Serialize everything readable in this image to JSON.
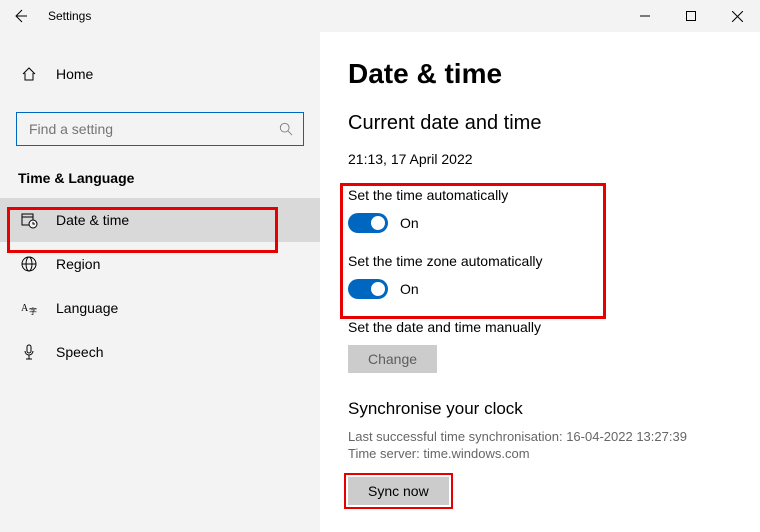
{
  "window": {
    "title": "Settings"
  },
  "sidebar": {
    "home": "Home",
    "search_placeholder": "Find a setting",
    "category": "Time & Language",
    "items": [
      {
        "label": "Date & time"
      },
      {
        "label": "Region"
      },
      {
        "label": "Language"
      },
      {
        "label": "Speech"
      }
    ]
  },
  "page": {
    "heading": "Date & time",
    "subheading": "Current date and time",
    "datetime": "21:13, 17 April 2022",
    "auto_time_label": "Set the time automatically",
    "auto_time_state": "On",
    "auto_tz_label": "Set the time zone automatically",
    "auto_tz_state": "On",
    "manual_label": "Set the date and time manually",
    "change_btn": "Change",
    "sync_heading": "Synchronise your clock",
    "sync_last": "Last successful time synchronisation: 16-04-2022 13:27:39",
    "sync_server": "Time server: time.windows.com",
    "sync_btn": "Sync now"
  }
}
